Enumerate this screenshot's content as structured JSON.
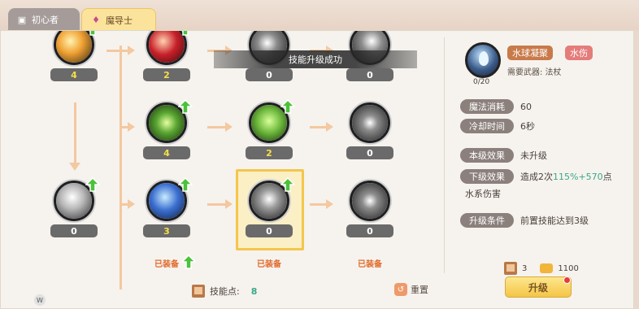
{
  "tabs": [
    {
      "label": "初心者",
      "icon": "treasure-chest-icon",
      "active": false
    },
    {
      "label": "魔导士",
      "icon": "magic-wand-icon",
      "active": true
    }
  ],
  "toast": "技能升级成功",
  "tree": {
    "nodes": [
      {
        "id": "r0c0",
        "level": "4",
        "icon": "lightning-icon",
        "color": "#f1a234"
      },
      {
        "id": "r0c1",
        "level": "2",
        "icon": "fire-orb-icon",
        "color": "#c8202a"
      },
      {
        "id": "r0c2",
        "level": "0",
        "icon": "starburst-icon",
        "color": "#777777"
      },
      {
        "id": "r0c3",
        "level": "0",
        "icon": "wind-slash-icon",
        "color": "#777777"
      },
      {
        "id": "r1c1",
        "level": "4",
        "icon": "nature-burst-icon",
        "color": "#5aa632"
      },
      {
        "id": "r1c2",
        "level": "2",
        "icon": "tornado-icon",
        "color": "#6db83c"
      },
      {
        "id": "r1c3",
        "level": "0",
        "icon": "lance-icon",
        "color": "#777777"
      },
      {
        "id": "r2c0",
        "level": "0",
        "icon": "wind-spiral-icon",
        "color": "#9a9a9a"
      },
      {
        "id": "r2c1",
        "level": "3",
        "icon": "ice-shard-icon",
        "color": "#3b6fd0"
      },
      {
        "id": "r2c2",
        "level": "0",
        "icon": "water-drop-icon",
        "color": "#8a8a8a"
      },
      {
        "id": "r2c3",
        "level": "0",
        "icon": "pillar-icon",
        "color": "#777777"
      }
    ],
    "equipped_label": "已装备"
  },
  "skill_points": {
    "label": "技能点:",
    "value": "8"
  },
  "reset_label": "重置",
  "detail": {
    "counter": "0/20",
    "name": "水球凝聚",
    "type": "水伤",
    "weapon": "需要武器: 法杖",
    "rows": [
      {
        "label": "魔法消耗",
        "value": "60"
      },
      {
        "label": "冷却时间",
        "value": "6秒"
      },
      {
        "label": "本级效果",
        "value": "未升级"
      },
      {
        "label": "下级效果",
        "value_prefix": "造成2次",
        "value_hl": "115%+570",
        "value_suffix": "点"
      },
      {
        "label": "升级条件",
        "value": "前置技能达到3级"
      }
    ],
    "next_effect_cont": "水系伤害"
  },
  "cost": {
    "book": "3",
    "gold": "1100"
  },
  "upgrade_label": "升级",
  "corner_badge": "W"
}
